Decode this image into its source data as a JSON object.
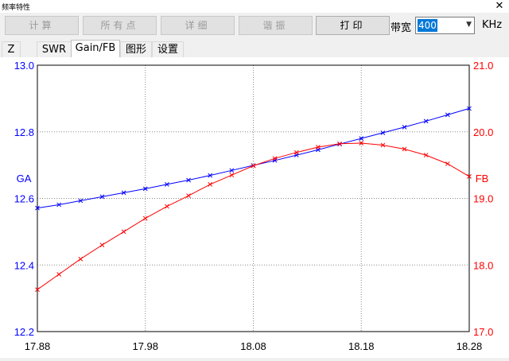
{
  "window": {
    "title": "频率特性",
    "close_glyph": "✕"
  },
  "toolbar": {
    "buttons": [
      {
        "label": "计算"
      },
      {
        "label": "所有点"
      },
      {
        "label": "详细"
      },
      {
        "label": "谐振"
      },
      {
        "label": "打印"
      }
    ],
    "bandwidth_label": "带宽",
    "bandwidth_value": "400",
    "bandwidth_unit": "KHz",
    "dropdown_icon": "chevron-down-icon"
  },
  "tabs": [
    {
      "label": "Z"
    },
    {
      "label": "SWR"
    },
    {
      "label": "Gain/FB",
      "active": true
    },
    {
      "label": "图形"
    },
    {
      "label": "设置"
    }
  ],
  "colors": {
    "ga": "#0000ff",
    "fb": "#ff0000",
    "grid": "#888888"
  },
  "chart_data": {
    "type": "line",
    "x_ticks": [
      "17.88",
      "17.98",
      "18.08",
      "18.18",
      "18.28"
    ],
    "xlim": [
      17.88,
      18.28
    ],
    "left_axis": {
      "label": "GA",
      "ylim": [
        12.2,
        13.0
      ],
      "ticks": [
        "12.2",
        "12.4",
        "12.6",
        "12.8",
        "13.0"
      ]
    },
    "right_axis": {
      "label": "FB",
      "ylim": [
        17.0,
        21.0
      ],
      "ticks": [
        "17.0",
        "18.0",
        "19.0",
        "20.0",
        "21.0"
      ]
    },
    "grid": true,
    "x": [
      17.88,
      17.9,
      17.92,
      17.94,
      17.96,
      17.98,
      18.0,
      18.02,
      18.04,
      18.06,
      18.08,
      18.1,
      18.12,
      18.14,
      18.16,
      18.18,
      18.2,
      18.22,
      18.24,
      18.26,
      18.28
    ],
    "series": [
      {
        "axis": "left",
        "values": [
          12.571,
          12.581,
          12.593,
          12.605,
          12.617,
          12.629,
          12.642,
          12.655,
          12.669,
          12.684,
          12.699,
          12.714,
          12.73,
          12.746,
          12.763,
          12.78,
          12.797,
          12.814,
          12.832,
          12.851,
          12.87
        ]
      },
      {
        "axis": "right",
        "values": [
          17.63,
          17.86,
          18.09,
          18.3,
          18.5,
          18.7,
          18.88,
          19.04,
          19.21,
          19.35,
          19.49,
          19.6,
          19.69,
          19.77,
          19.82,
          19.83,
          19.8,
          19.74,
          19.65,
          19.52,
          19.33
        ]
      }
    ]
  }
}
